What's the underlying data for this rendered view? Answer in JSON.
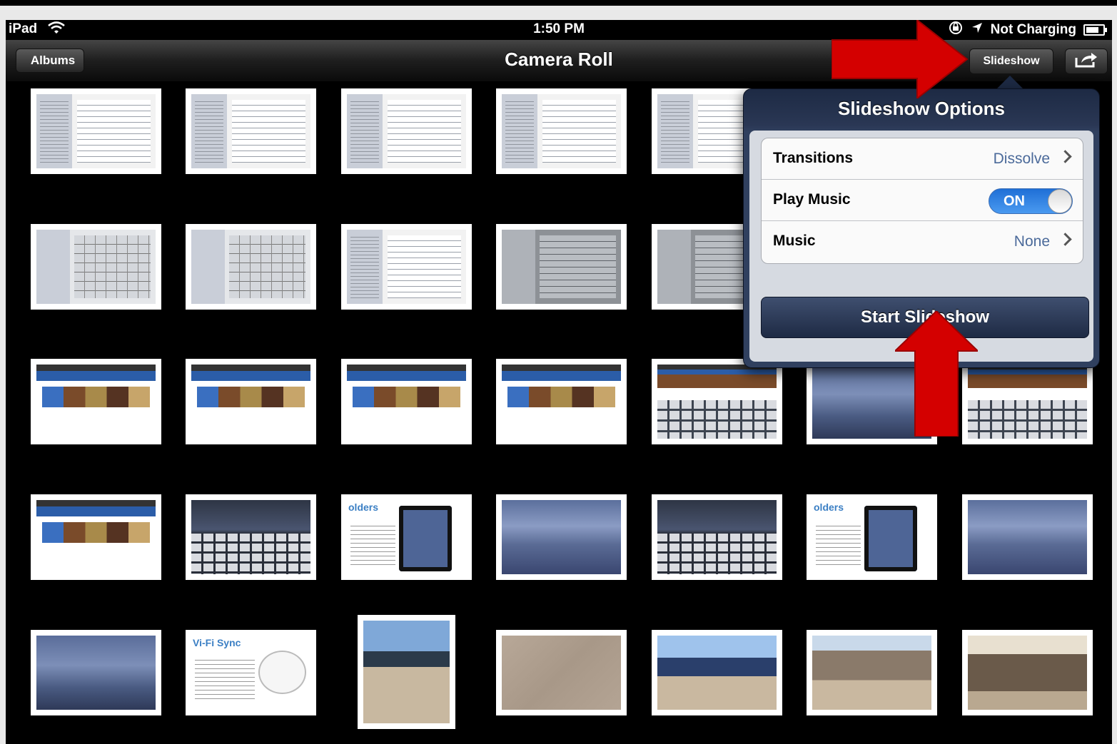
{
  "status_bar": {
    "carrier": "iPad",
    "time": "1:50 PM",
    "battery_text": "Not Charging"
  },
  "nav_bar": {
    "title": "Camera Roll",
    "back_button": "Albums",
    "slideshow_button": "Slideshow",
    "share_icon": "share-icon"
  },
  "thumbnails": [
    {
      "kind": "settings"
    },
    {
      "kind": "settings"
    },
    {
      "kind": "settings"
    },
    {
      "kind": "settings"
    },
    {
      "kind": "settings"
    },
    {
      "kind": "grid"
    },
    {
      "kind": "grid"
    },
    {
      "kind": "settings"
    },
    {
      "kind": "grey"
    },
    {
      "kind": "grey"
    },
    {
      "kind": "web"
    },
    {
      "kind": "web"
    },
    {
      "kind": "web"
    },
    {
      "kind": "web"
    },
    {
      "kind": "webkb"
    },
    {
      "kind": "home"
    },
    {
      "kind": "webkb"
    },
    {
      "kind": "web"
    },
    {
      "kind": "darkkb"
    },
    {
      "kind": "doc",
      "title": "olders"
    },
    {
      "kind": "sky"
    },
    {
      "kind": "darkkb"
    },
    {
      "kind": "doc",
      "title": "olders"
    },
    {
      "kind": "sky"
    },
    {
      "kind": "home"
    },
    {
      "kind": "wifi",
      "title": "Vi-Fi Sync"
    },
    {
      "kind": "photo-shade"
    },
    {
      "kind": "photo-concrete"
    },
    {
      "kind": "photo-play"
    },
    {
      "kind": "photo-rock"
    },
    {
      "kind": "photo-class"
    }
  ],
  "slideshow_options": {
    "title": "Slideshow Options",
    "transitions_label": "Transitions",
    "transitions_value": "Dissolve",
    "play_music_label": "Play Music",
    "play_music_state": "ON",
    "music_label": "Music",
    "music_value": "None",
    "start_button": "Start Slideshow"
  },
  "annotation_color": "#d40000"
}
